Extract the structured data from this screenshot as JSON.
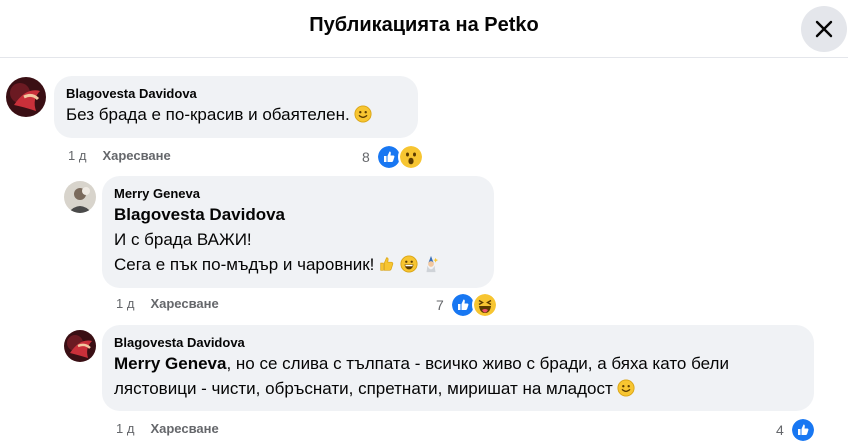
{
  "header": {
    "title": "Публикацията на Petko"
  },
  "comments": [
    {
      "author": "Blagovesta Davidova",
      "text": "Без брада е по-красив и обаятелен.",
      "time": "1 д",
      "like_label": "Харесване",
      "reaction_count": "8",
      "reactions": [
        "like-reaction-icon",
        "wow-reaction-icon"
      ]
    },
    {
      "author": "Merry Geneva",
      "mention": "Blagovesta Davidova",
      "line1": "И с брада ВАЖИ!",
      "line2": "Сега е пък по-мъдър и чаровник!",
      "time": "1 д",
      "like_label": "Харесване",
      "reaction_count": "7",
      "reactions": [
        "like-reaction-icon",
        "haha-reaction-icon"
      ]
    },
    {
      "author": "Blagovesta Davidova",
      "mention": "Merry Geneva",
      "text_after_mention": ", но се слива с тълпата - всичко живо с бради, а бяха като бели",
      "line2": "лястовици - чисти, обръснати, спретнати, миришат на младост",
      "time": "1 д",
      "like_label": "Харесване",
      "reaction_count": "4",
      "reactions": [
        "like-reaction-icon"
      ]
    }
  ],
  "colors": {
    "bubble": "#f0f2f5",
    "like_blue": "#1877f2",
    "meta_gray": "#65676b"
  }
}
